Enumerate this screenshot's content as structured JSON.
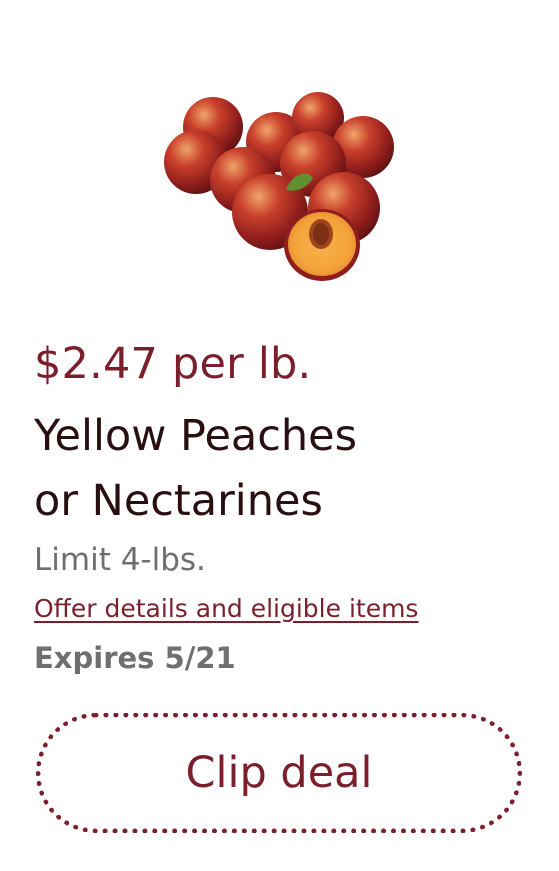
{
  "deal": {
    "price": "$2.47 per lb.",
    "title_line1": "Yellow Peaches",
    "title_line2": "or Nectarines",
    "limit": "Limit 4-lbs.",
    "offer_link": "Offer details and eligible items",
    "expires": "Expires 5/21",
    "clip_label": "Clip deal",
    "image_icon": "peaches-image"
  },
  "colors": {
    "accent": "#7a1f2b",
    "title": "#2a0f12",
    "muted": "#6f6f6f"
  }
}
